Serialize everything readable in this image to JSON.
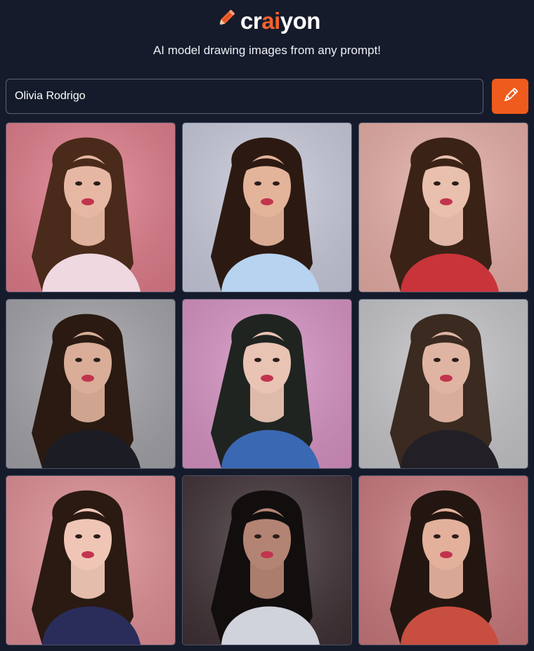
{
  "app": {
    "logo": {
      "text_before": "cr",
      "text_accent": "ai",
      "text_after": "yon",
      "icon": "pencil-icon"
    },
    "tagline": "AI model drawing images from any prompt!"
  },
  "prompt": {
    "value": "Olivia Rodrigo",
    "button_icon": "pencil-icon"
  },
  "colors": {
    "background": "#151b2b",
    "accent": "#ee5b1c",
    "border": "#5a6275"
  },
  "results": [
    {
      "bg": "#e07d8b",
      "hair": "#4a2a1a",
      "skin": "#e6b8a4",
      "top": "#f0d8e0"
    },
    {
      "bg": "#c9cbdc",
      "hair": "#2c1a12",
      "skin": "#e3b39a",
      "top": "#b7d3ef"
    },
    {
      "bg": "#e6aea6",
      "hair": "#3a2216",
      "skin": "#e9bfae",
      "top": "#c9343a"
    },
    {
      "bg": "#a3a3a8",
      "hair": "#2a1a12",
      "skin": "#d9ad98",
      "top": "#1c1c24"
    },
    {
      "bg": "#d793c4",
      "hair": "#1f2420",
      "skin": "#e9c3b3",
      "top": "#3b68b3"
    },
    {
      "bg": "#c6c6ca",
      "hair": "#3a2a20",
      "skin": "#e0b4a2",
      "top": "#222026"
    },
    {
      "bg": "#df8f95",
      "hair": "#2a1a12",
      "skin": "#efc6b5",
      "top": "#2a2c5a"
    },
    {
      "bg": "#3f3135",
      "hair": "#120e0e",
      "skin": "#b38473",
      "top": "#d0d2dc"
    },
    {
      "bg": "#c9797c",
      "hair": "#231610",
      "skin": "#e3b09c",
      "top": "#c84e40"
    }
  ]
}
